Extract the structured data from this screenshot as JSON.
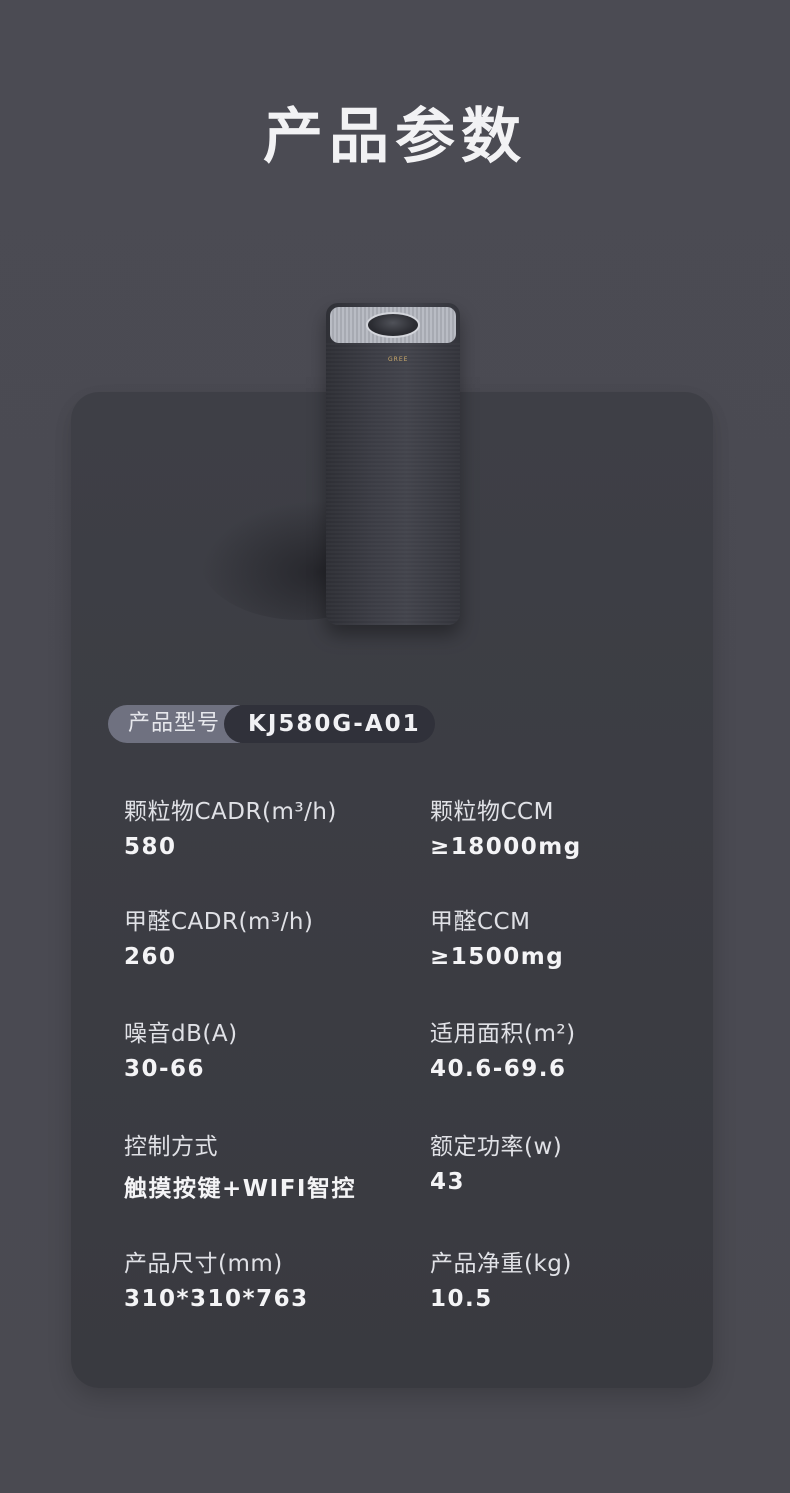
{
  "page": {
    "title": "产品参数"
  },
  "product": {
    "logo_text": "GREE"
  },
  "model": {
    "label": "产品型号",
    "value": "KJ580G-A01"
  },
  "specs": [
    {
      "label": "颗粒物CADR(m³/h)",
      "value": "580"
    },
    {
      "label": "颗粒物CCM",
      "value": "≥18000mg"
    },
    {
      "label": "甲醛CADR(m³/h)",
      "value": "260"
    },
    {
      "label": "甲醛CCM",
      "value": "≥1500mg"
    },
    {
      "label": "噪音dB(A)",
      "value": "30-66"
    },
    {
      "label": "适用面积(m²)",
      "value": "40.6-69.6"
    },
    {
      "label": "控制方式",
      "value": "触摸按键+WIFI智控"
    },
    {
      "label": "额定功率(w)",
      "value": "43"
    },
    {
      "label": "产品尺寸(mm)",
      "value": "310*310*763"
    },
    {
      "label": "产品净重(kg)",
      "value": "10.5"
    }
  ],
  "colors": {
    "background": "#4a4a52",
    "card": "#3c3d44",
    "pill_label": "#6f7180",
    "pill_value": "#30313a",
    "logo_gold": "#c9a86a"
  }
}
